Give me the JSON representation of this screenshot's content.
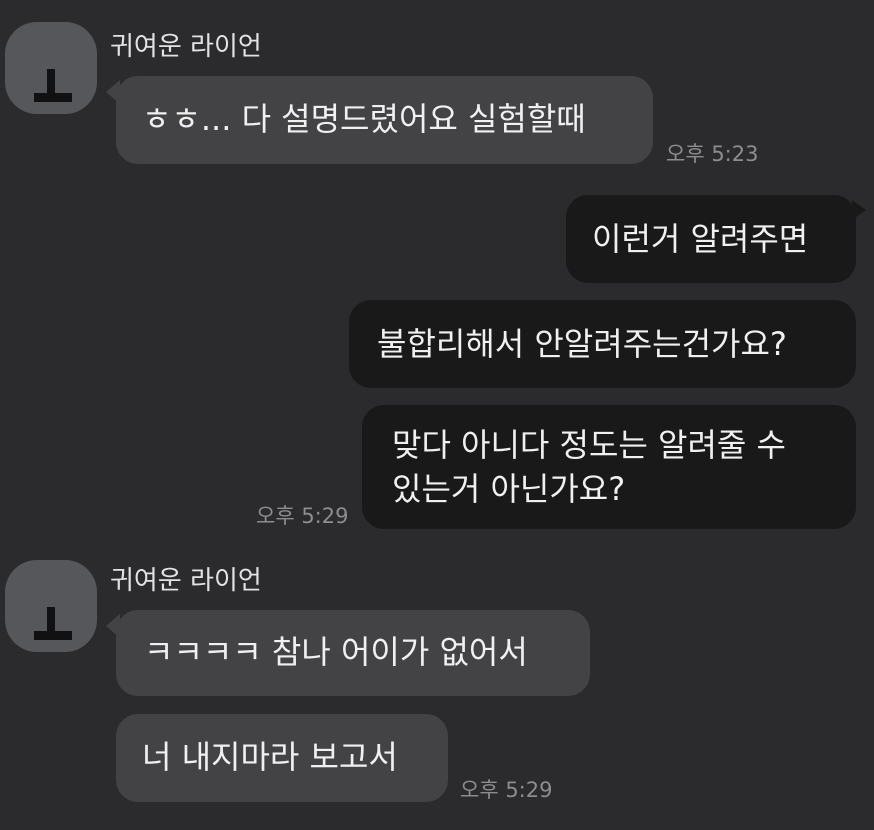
{
  "messages": [
    {
      "sender": "귀여운 라이언",
      "bubbles": [
        "ㅎㅎ... 다 설명드렸어요 실험할때"
      ],
      "time": "오후 5:23"
    },
    {
      "sender": "me",
      "bubbles": [
        "이런거 알려주면",
        "불합리해서 안알려주는건가요?",
        "맞다 아니다 정도는 알려줄 수",
        "있는거 아닌가요?"
      ],
      "time": "오후 5:29"
    },
    {
      "sender": "귀여운 라이언",
      "bubbles": [
        "ㅋㅋㅋㅋ 참나 어이가 없어서",
        "너 내지마라 보고서"
      ],
      "time": "오후 5:29"
    }
  ],
  "avatar_glyph": "ㅗ",
  "colors": {
    "background": "#2b2b2d",
    "incoming_bubble": "#434346",
    "outgoing_bubble": "#19191a",
    "avatar": "#56575b",
    "timestamp": "#8d8d90"
  }
}
